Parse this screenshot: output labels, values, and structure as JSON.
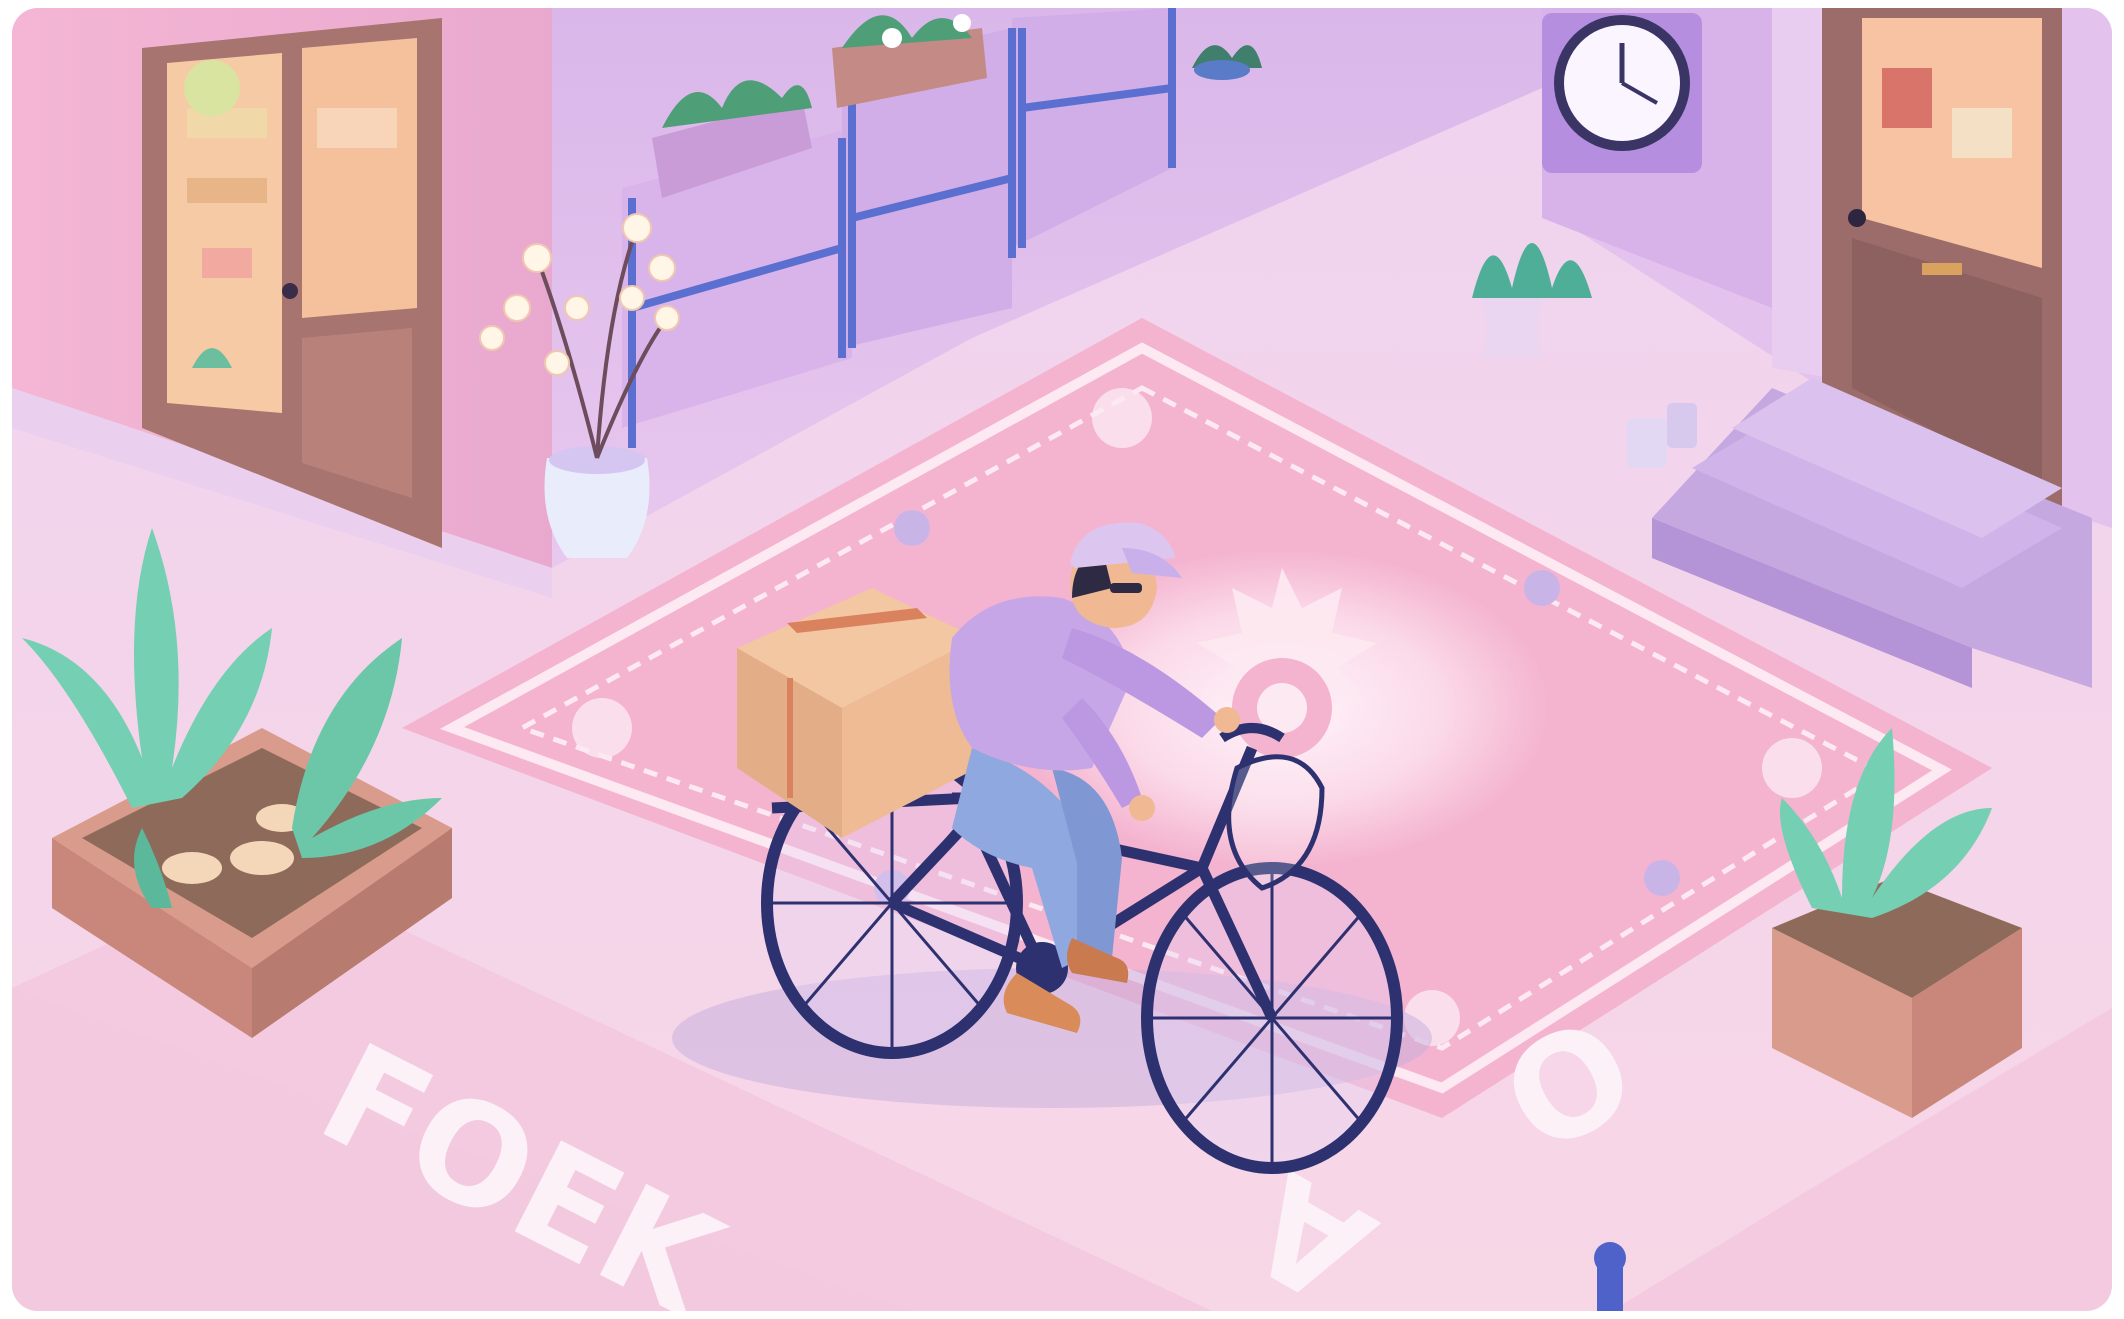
{
  "scene": {
    "subject": "delivery-cyclist",
    "street_lettering": [
      "FOEK",
      "O",
      "A"
    ],
    "colors": {
      "wall_pink": "#f2b8d7",
      "wall_lilac": "#d8bde9",
      "floor": "#f3d3e8",
      "rug": "#f4b3cf",
      "rug_pattern": "#fde9f1",
      "door_wood": "#a8746f",
      "bike_frame": "#2e3170",
      "shirt": "#c7a6e8",
      "jeans": "#8fa8df",
      "parcel": "#e8b58f",
      "leaves": "#74cfb3",
      "planter": "#d99b8c"
    }
  }
}
